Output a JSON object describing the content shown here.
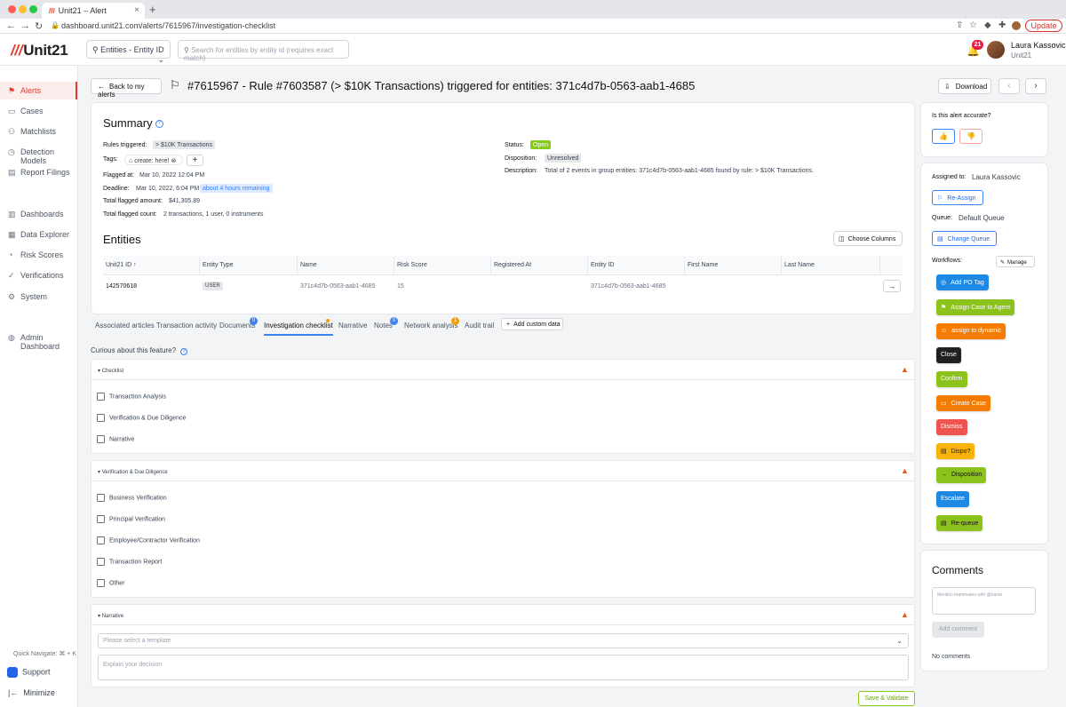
{
  "browser": {
    "tab_title": "Unit21 – Alert",
    "tab_logo": "///",
    "url": "dashboard.unit21.com/alerts/7615967/investigation-checklist",
    "update_label": "Update"
  },
  "header": {
    "logo_mark": "///",
    "logo_text": "Unit21",
    "entity_select": "Entities - Entity ID",
    "search_placeholder": "Search for entities by entity id (requires exact match)",
    "notification_count": "21",
    "user_name": "Laura Kassovic",
    "user_org": "Unit21"
  },
  "sidebar": {
    "items": [
      {
        "label": "Alerts",
        "icon": "flag-icon"
      },
      {
        "label": "Cases",
        "icon": "briefcase-icon"
      },
      {
        "label": "Matchlists",
        "icon": "user-plus-icon"
      },
      {
        "label": "Detection Models",
        "icon": "clock-icon"
      },
      {
        "label": "Report Filings",
        "icon": "document-icon"
      },
      {
        "label": "Dashboards",
        "icon": "chart-icon"
      },
      {
        "label": "Data Explorer",
        "icon": "table-icon"
      },
      {
        "label": "Risk Scores",
        "icon": "gauge-icon"
      },
      {
        "label": "Verifications",
        "icon": "check-user-icon"
      },
      {
        "label": "System",
        "icon": "gear-icon"
      },
      {
        "label": "Admin Dashboard",
        "icon": "globe-icon"
      }
    ],
    "quick_navigate": "Quick Navigate: ⌘ + K",
    "support": "Support",
    "minimize": "Minimize"
  },
  "page": {
    "back_label": "Back to my alerts",
    "title": "#7615967 - Rule #7603587 (> $10K Transactions) triggered for entities: 371c4d7b-0563-aab1-4685",
    "download_label": "Download"
  },
  "summary": {
    "title": "Summary",
    "rules_label": "Rules triggered:",
    "rules_value": "> $10K Transactions",
    "tags_label": "Tags:",
    "tag_value": "create: here!",
    "flagged_at_label": "Flagged at:",
    "flagged_at_value": "Mar 10, 2022 12:04 PM",
    "deadline_label": "Deadline:",
    "deadline_value": "Mar 10, 2022, 6:04 PM",
    "deadline_badge": "about 4 hours remaining",
    "amount_label": "Total flagged amount:",
    "amount_value": "$41,305.89",
    "count_label": "Total flagged count:",
    "count_value": "2 transactions, 1 user, 0 instruments",
    "status_label": "Status:",
    "status_value": "Open",
    "disposition_label": "Disposition:",
    "disposition_value": "Unresolved",
    "description_label": "Description:",
    "description_value": "Total of 2 events in group entities: 371c4d7b-0563-aab1-4685 found by rule: > $10K Transactions."
  },
  "entities": {
    "title": "Entities",
    "choose_columns": "Choose Columns",
    "columns": [
      "Unit21 ID ↑",
      "Entity Type",
      "Name",
      "Risk Score",
      "Registered At",
      "Entity ID",
      "First Name",
      "Last Name"
    ],
    "rows": [
      {
        "unit21_id": "142570618",
        "entity_type": "USER",
        "name": "371c4d7b-0563-aab1-4685",
        "risk_score": "15",
        "registered_at": "",
        "entity_id": "371c4d7b-0563-aab1-4685",
        "first_name": "",
        "last_name": ""
      }
    ]
  },
  "tabs": [
    {
      "label": "Associated articles"
    },
    {
      "label": "Transaction activity"
    },
    {
      "label": "Documents",
      "badge": "0"
    },
    {
      "label": "Investigation checklist",
      "active": true
    },
    {
      "label": "Narrative"
    },
    {
      "label": "Notes",
      "badge": "0"
    },
    {
      "label": "Network analysis",
      "badge": "1"
    },
    {
      "label": "Audit trail"
    }
  ],
  "add_custom_data": "Add custom data",
  "curious": "Curious about this feature?",
  "checklist": {
    "sections": [
      {
        "title": "Checklist",
        "items": [
          "Transaction Analysis",
          "Verification & Due Diligence",
          "Narrative"
        ]
      },
      {
        "title": "Verification & Due Diligence",
        "items": [
          "Business Verification",
          "Principal Verification",
          "Employee/Contractor Verification",
          "Transaction Report",
          "Other"
        ]
      },
      {
        "title": "Narrative"
      }
    ],
    "template_placeholder": "Please select a template",
    "explain_placeholder": "Explain your decision",
    "save_validate": "Save & Validate"
  },
  "right_panel": {
    "accurate_question": "Is this alert accurate?",
    "assigned_label": "Assigned to:",
    "assigned_value": "Laura Kassovic",
    "reassign": "Re-Assign",
    "queue_label": "Queue:",
    "queue_value": "Default Queue",
    "change_queue": "Change Queue",
    "workflows_label": "Workflows:",
    "manage": "Manage",
    "workflows": [
      {
        "label": "Add PO Tag",
        "color": "#1e88e5",
        "icon": "check-circle-icon"
      },
      {
        "label": "Assign Case to Agent",
        "color": "#8cc21c",
        "icon": "assign-icon"
      },
      {
        "label": "assign to dynamic",
        "color": "#f57c00",
        "icon": "person-icon"
      },
      {
        "label": "Close",
        "color": "#212121",
        "icon": ""
      },
      {
        "label": "Confirm",
        "color": "#8cc21c",
        "icon": ""
      },
      {
        "label": "Create Case",
        "color": "#f57c00",
        "icon": "briefcase-icon"
      },
      {
        "label": "Dismiss",
        "color": "#ef5350",
        "icon": ""
      },
      {
        "label": "Dispo?",
        "color": "#f9b208",
        "icon": "doc-icon"
      },
      {
        "label": "Disposition",
        "color": "#8cc21c",
        "icon": "arrow-right-icon"
      },
      {
        "label": "Escalate",
        "color": "#1e88e5",
        "icon": ""
      },
      {
        "label": "Re-queue",
        "color": "#8cc21c",
        "icon": "clipboard-icon"
      }
    ],
    "comments_title": "Comments",
    "comment_placeholder": "Mention teammates with @name",
    "add_comment": "Add comment",
    "no_comments": "No comments"
  }
}
